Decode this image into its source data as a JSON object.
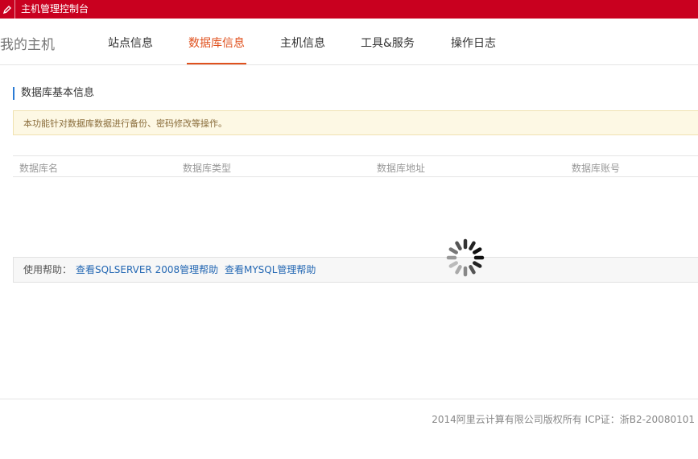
{
  "app": {
    "title": "主机管理控制台"
  },
  "header": {
    "brand": "我的主机",
    "tabs": [
      {
        "label": "站点信息",
        "active": false
      },
      {
        "label": "数据库信息",
        "active": true
      },
      {
        "label": "主机信息",
        "active": false
      },
      {
        "label": "工具&服务",
        "active": false
      },
      {
        "label": "操作日志",
        "active": false
      }
    ]
  },
  "section": {
    "title": "数据库基本信息",
    "notice": "本功能针对数据库数据进行备份、密码修改等操作。"
  },
  "table": {
    "columns": [
      "数据库名",
      "数据库类型",
      "数据库地址",
      "数据库账号"
    ],
    "rows": []
  },
  "help": {
    "label": "使用帮助：",
    "links": [
      "查看SQLSERVER 2008管理帮助",
      "查看MYSQL管理帮助"
    ]
  },
  "footer": {
    "copyright": "2014阿里云计算有限公司版权所有 ICP证：浙B2-20080101"
  },
  "colors": {
    "topbar": "#c9001f",
    "accent": "#e0511e",
    "link": "#2367b3",
    "notice_bg": "#fdf8e4"
  }
}
